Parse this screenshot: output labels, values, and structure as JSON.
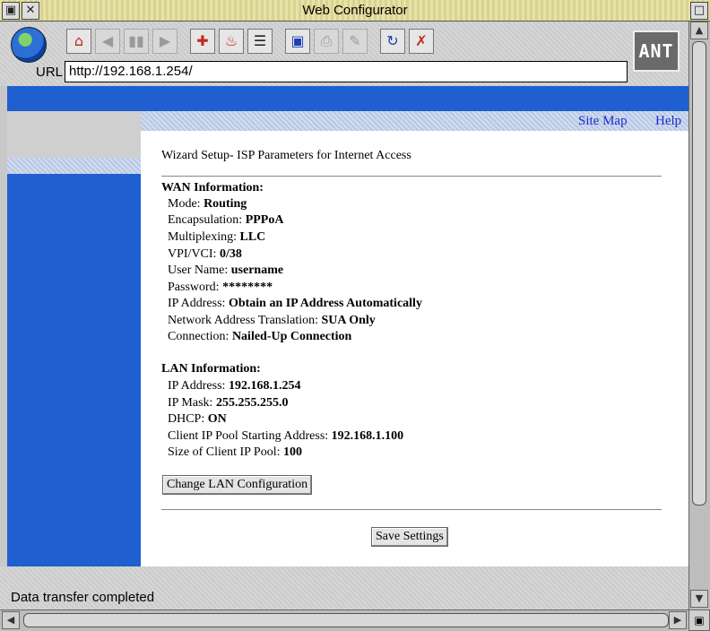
{
  "window": {
    "title": "Web Configurator"
  },
  "toolbar": {
    "url_label": "URL",
    "url_value": "http://192.168.1.254/",
    "logo_text": "ANT"
  },
  "nav": {
    "site_map": "Site Map",
    "help": "Help"
  },
  "content": {
    "heading": "Wizard Setup- ISP Parameters for Internet Access",
    "wan": {
      "title": "WAN Information:",
      "rows": [
        {
          "label": "Mode: ",
          "value": "Routing"
        },
        {
          "label": "Encapsulation: ",
          "value": "PPPoA"
        },
        {
          "label": "Multiplexing: ",
          "value": "LLC"
        },
        {
          "label": "VPI/VCI: ",
          "value": "0/38"
        },
        {
          "label": "User Name: ",
          "value": "username"
        },
        {
          "label": "Password: ",
          "value": "********"
        },
        {
          "label": "IP Address: ",
          "value": "Obtain an IP Address Automatically"
        },
        {
          "label": "Network Address Translation: ",
          "value": "SUA Only"
        },
        {
          "label": "Connection: ",
          "value": "Nailed-Up Connection"
        }
      ]
    },
    "lan": {
      "title": "LAN Information:",
      "rows": [
        {
          "label": "IP Address: ",
          "value": "192.168.1.254"
        },
        {
          "label": "IP Mask: ",
          "value": "255.255.255.0"
        },
        {
          "label": "DHCP: ",
          "value": "ON"
        },
        {
          "label": "Client IP Pool Starting Address: ",
          "value": "192.168.1.100"
        },
        {
          "label": "Size of Client IP Pool: ",
          "value": "100"
        }
      ]
    },
    "change_lan_button": "Change LAN Configuration",
    "save_button": "Save Settings"
  },
  "status": {
    "text": "Data transfer completed"
  },
  "colors": {
    "accent_blue": "#1f5fcf",
    "link_blue": "#1a2ccf"
  },
  "icons": {
    "toolbar": [
      "globe-icon",
      "home-icon",
      "back-icon",
      "stop-icon",
      "forward-icon",
      "add-hotlist-icon",
      "hotlist-icon",
      "history-icon",
      "save-icon",
      "print-icon",
      "edit-icon",
      "reload-icon",
      "close-page-icon"
    ]
  }
}
